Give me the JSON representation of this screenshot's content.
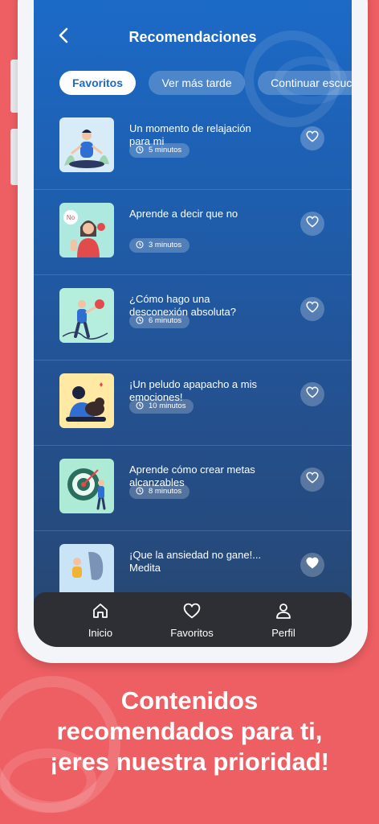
{
  "header": {
    "title": "Recomendaciones"
  },
  "tabs": [
    {
      "label": "Favoritos"
    },
    {
      "label": "Ver más tarde"
    },
    {
      "label": "Continuar escuchar"
    }
  ],
  "items": [
    {
      "title": "Un momento de relajación para mi",
      "duration": "5 minutos",
      "favorite": false
    },
    {
      "title": "Aprende a decir que no",
      "duration": "3 minutos",
      "favorite": false
    },
    {
      "title": "¿Cómo hago una desconexión absoluta?",
      "duration": "6 minutos",
      "favorite": false
    },
    {
      "title": "¡Un peludo apapacho a mis emociones!",
      "duration": "10 minutos",
      "favorite": false
    },
    {
      "title": "Aprende cómo crear metas alcanzables",
      "duration": "8 minutos",
      "favorite": false
    },
    {
      "title": "¡Que la ansiedad no gane!... Medita",
      "duration": "",
      "favorite": true
    }
  ],
  "thumbs": {
    "0": {
      "bg": "#d8ecf7",
      "badge": ""
    },
    "1": {
      "bg": "#aee9e0",
      "badge": "No"
    },
    "2": {
      "bg": "#b6eedd",
      "badge": ""
    },
    "3": {
      "bg": "#ffe9a3",
      "badge": ""
    },
    "4": {
      "bg": "#aeebd6",
      "badge": ""
    },
    "5": {
      "bg": "#c9e3f7",
      "badge": ""
    }
  },
  "nav": [
    {
      "label": "Inicio",
      "icon": "home-icon"
    },
    {
      "label": "Favoritos",
      "icon": "heart-icon"
    },
    {
      "label": "Perfil",
      "icon": "user-icon"
    }
  ],
  "slogan": {
    "line1": "Contenidos",
    "line2": "recomendados para ti,",
    "line3": "¡eres nuestra prioridad!"
  },
  "colors": {
    "background": "#ee5f63",
    "screen_top": "#1b6bc9",
    "screen_bottom": "#27466f",
    "nav_bar": "#2d2f34"
  }
}
